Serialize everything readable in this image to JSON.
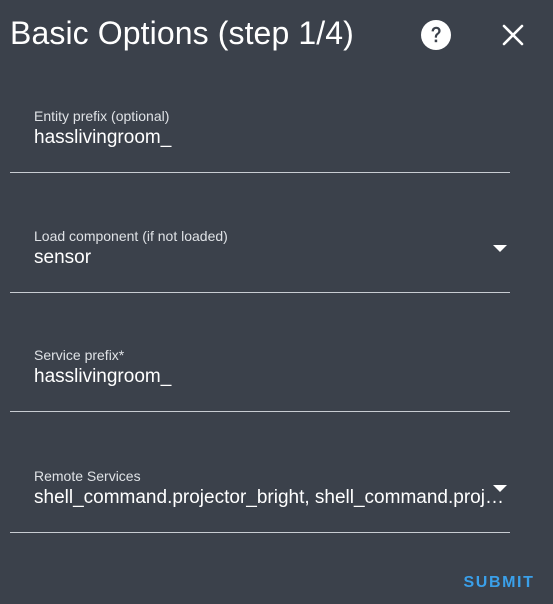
{
  "dialog": {
    "title": "Basic Options (step 1/4)",
    "help_icon": "help-circle-icon",
    "close_icon": "close-icon"
  },
  "fields": [
    {
      "label": "Entity prefix (optional)",
      "value": "hasslivingroom_",
      "type": "text"
    },
    {
      "label": "Load component (if not loaded)",
      "value": "sensor",
      "type": "dropdown"
    },
    {
      "label": "Service prefix*",
      "value": "hasslivingroom_",
      "type": "text"
    },
    {
      "label": "Remote Services",
      "value": "shell_command.projector_bright, shell_command.projector_normal",
      "type": "dropdown"
    }
  ],
  "actions": {
    "submit_label": "SUBMIT"
  },
  "colors": {
    "background": "#3b414b",
    "text": "#ffffff",
    "label": "#dfe2e6",
    "underline": "#c8ccd2",
    "accent": "#3aa0ea"
  }
}
